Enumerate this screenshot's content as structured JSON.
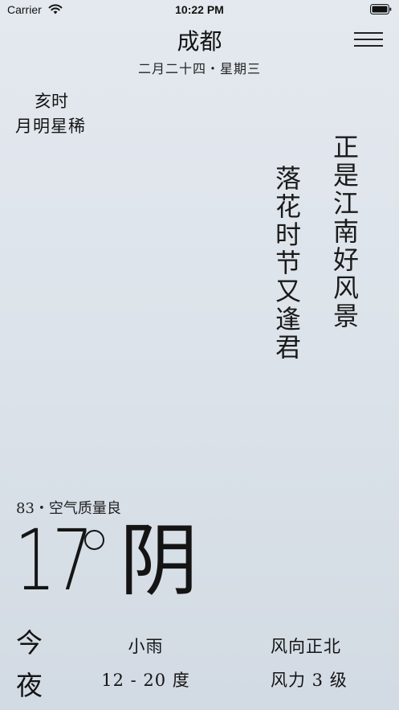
{
  "status_bar": {
    "carrier": "Carrier",
    "time": "10:22 PM",
    "wifi_icon": "wifi-icon",
    "battery_icon": "battery-icon"
  },
  "header": {
    "city": "成都",
    "date": "二月二十四・星期三",
    "menu_icon": "hamburger-menu-icon"
  },
  "time_period": {
    "hour": "亥时",
    "description": "月明星稀"
  },
  "poem": {
    "line1": "正是江南好风景",
    "line2": "落花时节又逢君"
  },
  "weather": {
    "aqi": "83・空气质量良",
    "temperature": "17",
    "condition": "阴"
  },
  "forecast": {
    "day_label_1": "今",
    "day_label_2": "夜",
    "weather": "小雨",
    "temp_range": "12 - 20 度",
    "wind_direction": "风向正北",
    "wind_level": "风力 3 级"
  },
  "colors": {
    "background_top": "#e4e9ef",
    "background_bottom": "#d2dae3",
    "text": "#141414"
  }
}
